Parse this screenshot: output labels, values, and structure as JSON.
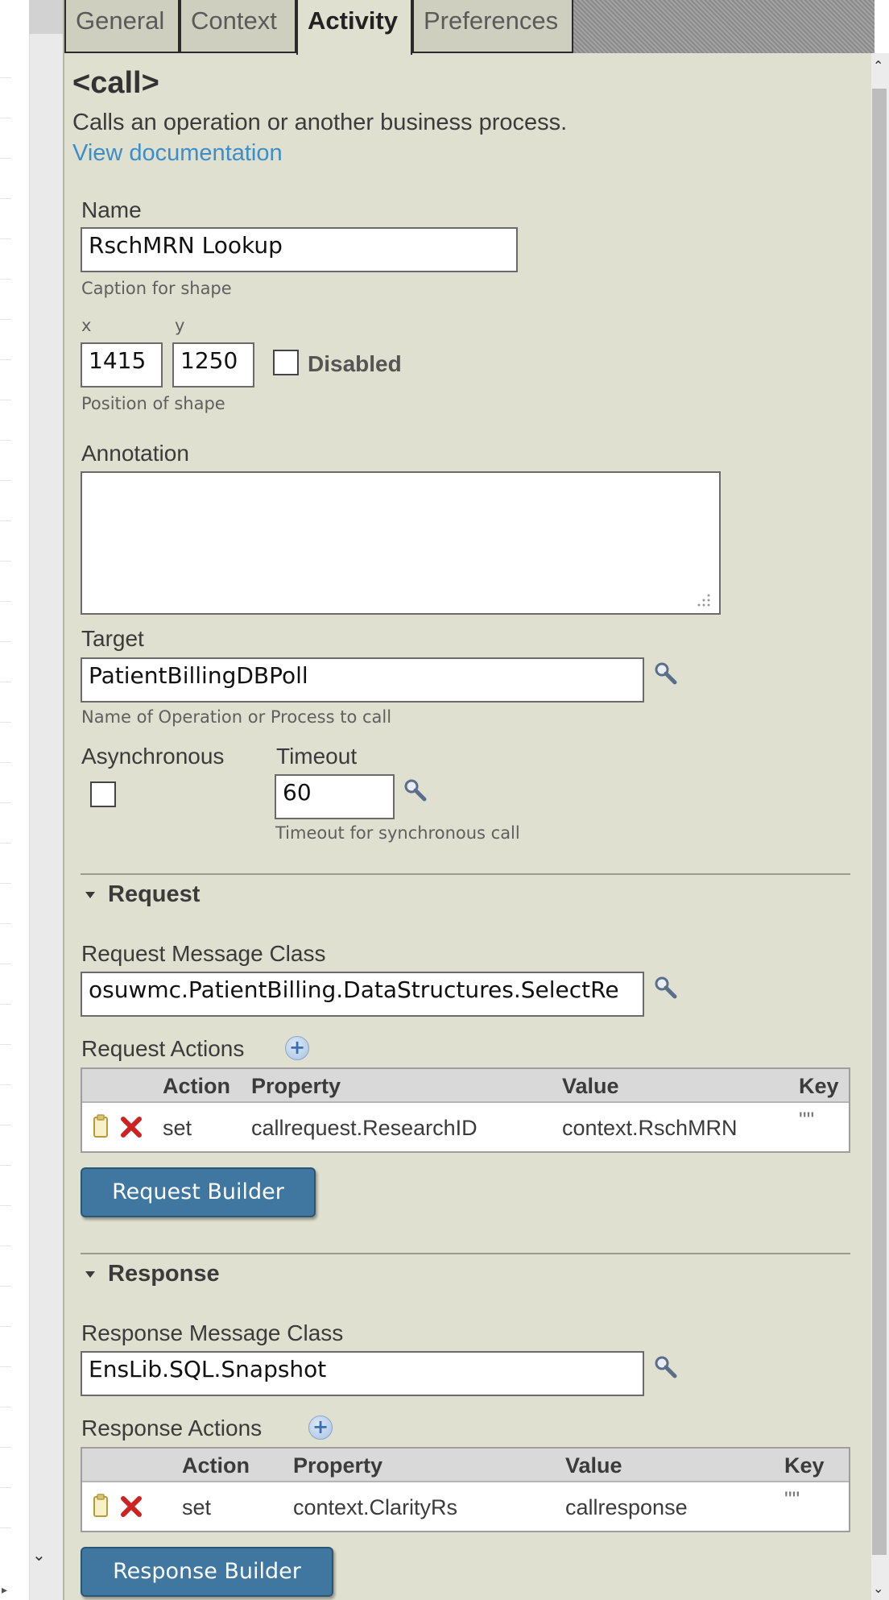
{
  "tabs": [
    {
      "label": "General",
      "active": false
    },
    {
      "label": "Context",
      "active": false
    },
    {
      "label": "Activity",
      "active": true
    },
    {
      "label": "Preferences",
      "active": false
    }
  ],
  "activity": {
    "title": "<call>",
    "description": "Calls an operation or another business process.",
    "doc_link": "View documentation"
  },
  "form": {
    "name_label": "Name",
    "name_value": "RschMRN Lookup",
    "name_hint": "Caption for shape",
    "x_label": "x",
    "y_label": "y",
    "x_value": "1415",
    "y_value": "1250",
    "disabled_label": "Disabled",
    "disabled_checked": false,
    "position_hint": "Position of shape",
    "annotation_label": "Annotation",
    "annotation_value": "",
    "target_label": "Target",
    "target_value": "PatientBillingDBPoll",
    "target_hint": "Name of Operation or Process to call",
    "async_label": "Asynchronous",
    "async_checked": false,
    "timeout_label": "Timeout",
    "timeout_value": "60",
    "timeout_hint": "Timeout for synchronous call"
  },
  "request": {
    "section_label": "Request",
    "message_class_label": "Request Message Class",
    "message_class_value": "osuwmc.PatientBilling.DataStructures.SelectRe",
    "actions_label": "Request Actions",
    "columns": [
      "Action",
      "Property",
      "Value",
      "Key"
    ],
    "rows": [
      {
        "action": "set",
        "property": "callrequest.ResearchID",
        "value": "context.RschMRN",
        "key": "\"\""
      }
    ],
    "builder_button": "Request Builder"
  },
  "response": {
    "section_label": "Response",
    "message_class_label": "Response Message Class",
    "message_class_value": "EnsLib.SQL.Snapshot",
    "actions_label": "Response Actions",
    "columns": [
      "Action",
      "Property",
      "Value",
      "Key"
    ],
    "rows": [
      {
        "action": "set",
        "property": "context.ClarityRs",
        "value": "callresponse",
        "key": "\"\""
      }
    ],
    "builder_button": "Response Builder"
  },
  "colors": {
    "panel_bg": "#e0e0d0",
    "link": "#3b8ec8",
    "button": "#3f77a0",
    "delete_icon": "#cc2222"
  },
  "icons": {
    "search": "magnifier-icon",
    "edit": "document-icon",
    "delete": "red-x-icon",
    "add": "plus-icon",
    "collapse": "triangle-down-icon"
  }
}
